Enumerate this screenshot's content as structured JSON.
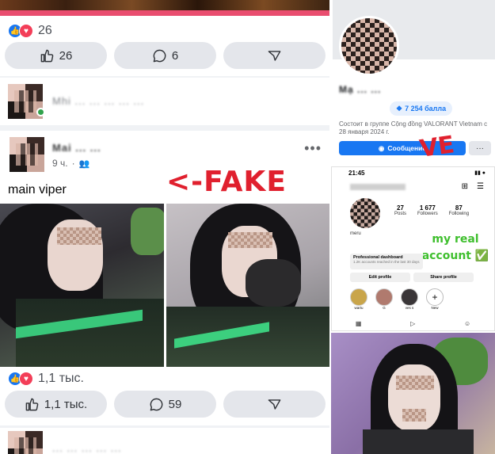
{
  "left_feed": {
    "post1": {
      "reaction_count": "26",
      "like_button_count": "26",
      "comment_button_count": "6"
    },
    "comment_preview": {
      "text": "Mhi ... ... ... ... ..."
    },
    "post2": {
      "author": "Mai ... ...",
      "time": "9 ч.",
      "caption": "main viper",
      "reaction_count": "1,1 тыс.",
      "like_button_count": "1,1 тыс.",
      "comment_button_count": "59"
    },
    "next_preview": {
      "text": "... ... ... ... ..."
    }
  },
  "annotation_fake": "<-FAKE",
  "right_profile": {
    "name": "Mạ ... ...",
    "points_badge": "7 254 балла",
    "member_text": "Состоит в группе Cộng đồng VALORANT Vietnam с 28 января 2024 г.",
    "message_button": "Сообщение"
  },
  "instagram": {
    "time": "21:45",
    "stats": [
      {
        "value": "27",
        "label": "Posts"
      },
      {
        "value": "1 677",
        "label": "Followers"
      },
      {
        "value": "87",
        "label": "Following"
      }
    ],
    "handle": "meru",
    "pro_dashboard_title": "Professional dashboard",
    "pro_dashboard_sub": "1.2K accounts reached in the last 30 days.",
    "edit_profile": "Edit profile",
    "share_profile": "Share profile",
    "highlights": [
      "wartu",
      "G",
      "ves s",
      "New"
    ]
  },
  "annotation_real": "my real account ✅",
  "colors": {
    "fb_blue": "#1877f2",
    "fake_red": "#e0202e",
    "real_green": "#3fbf2e"
  }
}
